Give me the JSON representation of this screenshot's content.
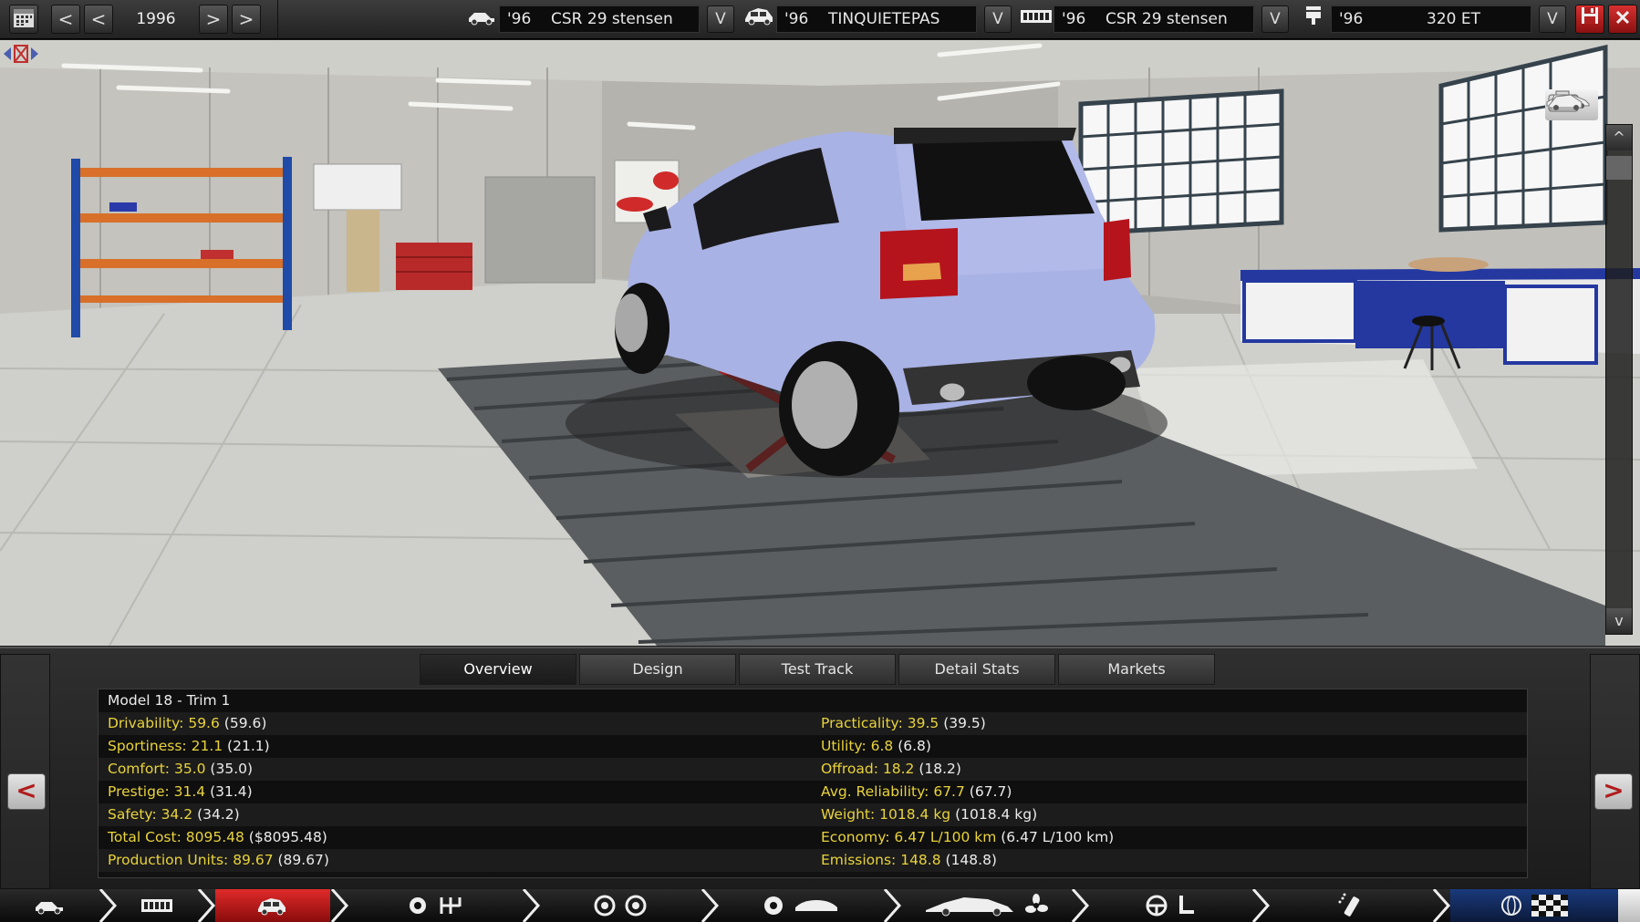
{
  "topbar": {
    "year": "1996",
    "chassis": {
      "year": "'96",
      "name": "CSR 29 stensen",
      "icon": "chassis-icon"
    },
    "model": {
      "year": "'96",
      "name": "TINQUIETEPAS",
      "icon": "car-body-icon"
    },
    "engine": {
      "year": "'96",
      "name": "CSR 29 stensen",
      "icon": "engine-block-icon"
    },
    "engine_variant": {
      "year": "'96",
      "name": "320 ET",
      "icon": "piston-icon"
    },
    "dropdown_glyph": "V",
    "prev_fast_glyph": "<",
    "prev_glyph": "<",
    "next_glyph": ">",
    "next_fast_glyph": ">"
  },
  "viewport": {
    "car_color": "#aab3e6",
    "scroll_up_glyph": "^",
    "scroll_down_glyph": "v"
  },
  "tabs": [
    {
      "label": "Overview",
      "active": true
    },
    {
      "label": "Design",
      "active": false
    },
    {
      "label": "Test Track",
      "active": false
    },
    {
      "label": "Detail Stats",
      "active": false
    },
    {
      "label": "Markets",
      "active": false
    }
  ],
  "stats": {
    "title": "Model 18 - Trim 1",
    "left": [
      {
        "label": "Drivability:",
        "value": "59.6",
        "ref": "(59.6)"
      },
      {
        "label": "Sportiness:",
        "value": "21.1",
        "ref": "(21.1)"
      },
      {
        "label": "Comfort:",
        "value": "35.0",
        "ref": "(35.0)"
      },
      {
        "label": "Prestige:",
        "value": "31.4",
        "ref": "(31.4)"
      },
      {
        "label": "Safety:",
        "value": "34.2",
        "ref": "(34.2)"
      },
      {
        "label": "Total Cost:",
        "value": "8095.48",
        "ref": "($8095.48)"
      },
      {
        "label": "Production Units:",
        "value": "89.67",
        "ref": "(89.67)"
      }
    ],
    "right": [
      {
        "label": "Practicality:",
        "value": "39.5",
        "ref": "(39.5)"
      },
      {
        "label": "Utility:",
        "value": "6.8",
        "ref": "(6.8)"
      },
      {
        "label": "Offroad:",
        "value": "18.2",
        "ref": "(18.2)"
      },
      {
        "label": "Avg. Reliability:",
        "value": "67.7",
        "ref": "(67.7)"
      },
      {
        "label": "Weight:",
        "value": "1018.4 kg",
        "ref": "(1018.4 kg)"
      },
      {
        "label": "Economy:",
        "value": "6.47 L/100 km",
        "ref": "(6.47 L/100 km)"
      },
      {
        "label": "Emissions:",
        "value": "148.8",
        "ref": "(148.8)"
      }
    ]
  },
  "panel": {
    "prev_glyph": "<",
    "next_glyph": ">"
  },
  "bottomnav": [
    {
      "icons": [
        "chassis-icon"
      ],
      "active": false
    },
    {
      "icons": [
        "engine-block-icon"
      ],
      "active": false
    },
    {
      "icons": [
        "car-body-icon"
      ],
      "active": true
    },
    {
      "icons": [
        "gear-icon",
        "gearbox-icon"
      ],
      "active": false
    },
    {
      "icons": [
        "wheel-icon",
        "wheel-icon"
      ],
      "active": false
    },
    {
      "icons": [
        "dial-icon",
        "car-body-icon"
      ],
      "active": false
    },
    {
      "icons": [
        "car-silhouette-icon",
        "fan-icon"
      ],
      "active": false
    },
    {
      "icons": [
        "steering-wheel-icon",
        "seat-icon"
      ],
      "active": false
    },
    {
      "icons": [
        "spray-paint-icon"
      ],
      "active": false
    },
    {
      "icons": [
        "globe-icon",
        "checkered-flag-icon"
      ],
      "active": false
    }
  ]
}
